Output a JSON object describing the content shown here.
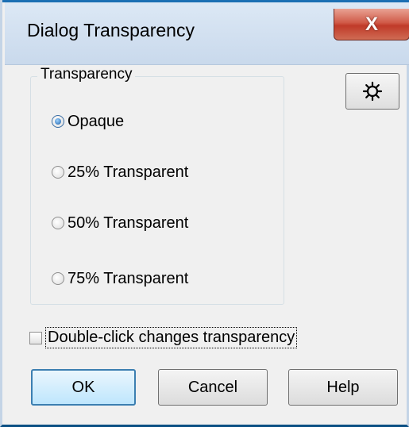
{
  "dialog": {
    "title": "Dialog Transparency",
    "close_glyph": "X"
  },
  "transparency_group": {
    "label": "Transparency",
    "options": [
      {
        "label": "Opaque",
        "checked": true
      },
      {
        "label": "25% Transparent",
        "checked": false
      },
      {
        "label": "50% Transparent",
        "checked": false
      },
      {
        "label": "75% Transparent",
        "checked": false
      }
    ]
  },
  "settings_button": {
    "icon": "gear-icon"
  },
  "double_click": {
    "label": "Double-click changes transparency",
    "checked": false
  },
  "buttons": {
    "ok": "OK",
    "cancel": "Cancel",
    "help": "Help"
  },
  "colors": {
    "title_bar": "#c9d9ec",
    "close_button": "#c8432f",
    "dialog_bg": "#f0f0f0",
    "default_button_border": "#3c7fb1"
  }
}
